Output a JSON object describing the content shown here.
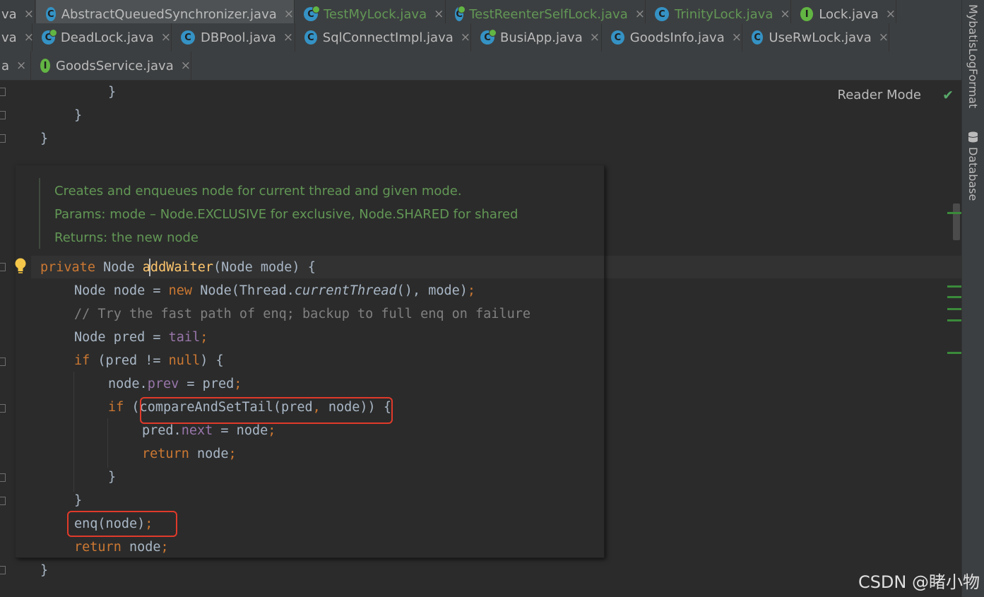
{
  "tabs": {
    "row1": [
      {
        "label": "va",
        "active": false
      },
      {
        "label": "AbstractQueuedSynchronizer.java",
        "active": true
      },
      {
        "label": "TestMyLock.java"
      },
      {
        "label": "TestReenterSelfLock.java"
      },
      {
        "label": "TrinityLock.java"
      },
      {
        "label": "Lock.java"
      }
    ],
    "row2": [
      {
        "label": "va"
      },
      {
        "label": "DeadLock.java"
      },
      {
        "label": "DBPool.java"
      },
      {
        "label": "SqlConnectImpl.java"
      },
      {
        "label": "BusiApp.java"
      },
      {
        "label": "GoodsInfo.java"
      },
      {
        "label": "UseRwLock.java"
      }
    ],
    "row3": [
      {
        "label": "a"
      },
      {
        "label": "GoodsService.java"
      }
    ],
    "close_glyph": "×"
  },
  "editor": {
    "reader_mode": "Reader Mode",
    "doc": {
      "line1": "Creates and enqueues node for current thread and given mode.",
      "line2": "Params:  mode – Node.EXCLUSIVE for exclusive, Node.SHARED for shared",
      "line3": "Returns: the new node"
    },
    "code": {
      "l1_brace": "}",
      "l2_brace": "}",
      "l3_brace": "}",
      "sig_kw": "private",
      "sig_type": " Node ",
      "sig_fn": "addWaiter",
      "sig_rest": "(Node mode) {",
      "n1_a": "Node node = ",
      "n1_new": "new",
      "n1_b": " Node(Thread.",
      "n1_it": "currentThread",
      "n1_c": "(), mode)",
      "semi": ";",
      "comment": "// Try the fast path of enq; backup to full enq on failure",
      "p1_a": "Node pred = ",
      "p1_tail": "tail",
      "if1_kw": "if",
      "if1_a": " (pred != ",
      "if1_null": "null",
      "if1_b": ") {",
      "prev_a": "node.",
      "prev_fld": "prev",
      "prev_b": " = pred",
      "if2_kw": "if",
      "if2_a": " (compareAndSetTail(pred",
      "comma": ",",
      "if2_b": " node)) {",
      "next_a": "pred.",
      "next_fld": "next",
      "next_b": " = node",
      "ret_kw": "return",
      "ret_node": " node",
      "c_brace1": "}",
      "c_brace2": "}",
      "enq": "enq(node)",
      "ret2_kw": "return",
      "ret2_node": " node",
      "c_brace3": "}"
    }
  },
  "right_panel": {
    "mybatis": "MybatisLogFormat",
    "database": "Database"
  },
  "watermark": "CSDN @睹小物",
  "colors": {
    "keyword": "#cc7832",
    "method": "#ffc66d",
    "field": "#9876aa",
    "doc": "#629755",
    "highlight": "#e03a2a"
  }
}
